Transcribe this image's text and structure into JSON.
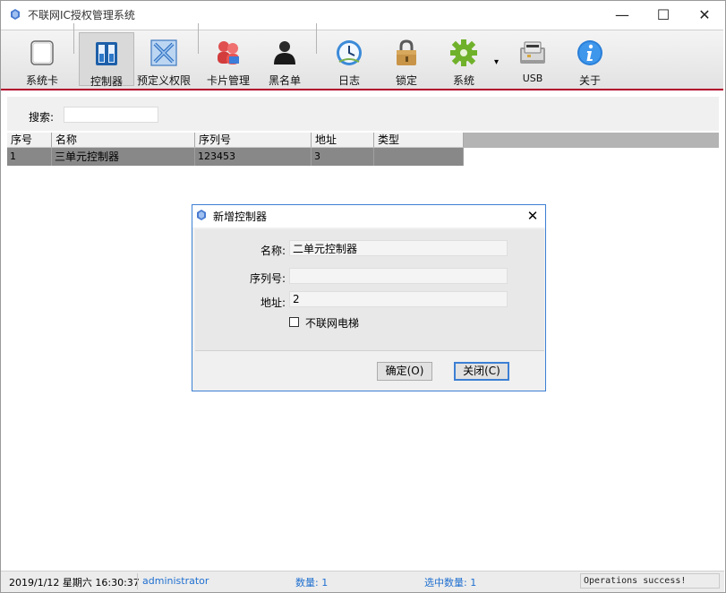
{
  "window": {
    "title": "不联网IC授权管理系统"
  },
  "window_controls": {
    "minimize": "—",
    "maximize": "☐",
    "close": "✕"
  },
  "toolbar": {
    "items": [
      {
        "label": "系统卡",
        "icon": "system-card-icon"
      },
      {
        "label": "控制器",
        "icon": "controller-icon",
        "selected": true
      },
      {
        "label": "预定义权限",
        "icon": "permission-icon"
      },
      {
        "label": "卡片管理",
        "icon": "card-manage-icon"
      },
      {
        "label": "黑名单",
        "icon": "blacklist-icon"
      },
      {
        "label": "日志",
        "icon": "log-clock-icon"
      },
      {
        "label": "锁定",
        "icon": "lock-icon"
      },
      {
        "label": "系统",
        "icon": "gear-icon"
      },
      {
        "label": "USB",
        "icon": "usb-card-reader-icon"
      },
      {
        "label": "关于",
        "icon": "info-icon"
      }
    ],
    "dropdown_arrow": "▾"
  },
  "search": {
    "label": "搜索:",
    "value": ""
  },
  "table": {
    "columns": [
      "序号",
      "名称",
      "序列号",
      "地址",
      "类型"
    ],
    "rows": [
      {
        "index": "1",
        "name": "三单元控制器",
        "serial": "123453",
        "address": "3",
        "type": ""
      }
    ]
  },
  "dialog": {
    "title": "新增控制器",
    "close_glyph": "✕",
    "fields": {
      "name": {
        "label": "名称:",
        "value": "二单元控制器"
      },
      "serial": {
        "label": "序列号:",
        "value": ""
      },
      "address": {
        "label": "地址:",
        "value": "2"
      }
    },
    "checkbox": {
      "label": "不联网电梯",
      "checked": false
    },
    "ok_label": "确定(O)",
    "close_label": "关闭(C)"
  },
  "statusbar": {
    "datetime": "2019/1/12 星期六 16:30:37",
    "user": "administrator",
    "count": "数量: 1",
    "selected": "选中数量: 1",
    "message": "Operations success!"
  },
  "colors": {
    "accent_line": "#b2002d",
    "link_blue": "#1e6fd0",
    "dialog_border": "#3c7fd4"
  }
}
